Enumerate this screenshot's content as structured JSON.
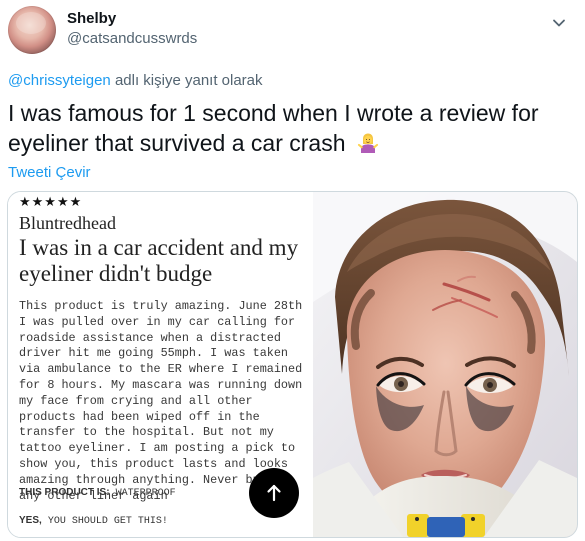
{
  "user": {
    "name": "Shelby",
    "handle": "@catsandcusswrds"
  },
  "reply": {
    "mention": "@chrissyteigen",
    "suffix": " adlı kişiye yanıt olarak"
  },
  "tweet": {
    "text": "I was famous for 1 second when I wrote a review for eyeliner that survived a car crash"
  },
  "actions": {
    "translate_label": "Tweeti Çevir"
  },
  "review": {
    "stars": "★★★★★",
    "author": "Bluntredhead",
    "title": "I was in a car accident and my eyeliner didn't budge",
    "body": "This product is truly amazing. June 28th I was pulled over in my car calling for roadside assistance when a distracted driver hit me going 55mph. I was taken via ambulance to the ER where I remained for 8 hours. My mascara was running down my face from crying and all other products had been wiped off in the transfer to the hospital. But not my tattoo eyeliner. I am posting a pick to show you, this product lasts and looks amazing through anything. Never buying any other liner again",
    "product_label": "THIS PRODUCT IS:",
    "product_value": "WATERPROOF",
    "recommend_label": "YES,",
    "recommend_value": "YOU SHOULD GET THIS!"
  },
  "icons": {
    "more": "more-icon",
    "scroll_top": "arrow-up-icon",
    "emoji": "woman-shrugging-emoji"
  },
  "colors": {
    "link": "#1d9bf0",
    "muted": "#536471",
    "border": "#cfd9de"
  }
}
